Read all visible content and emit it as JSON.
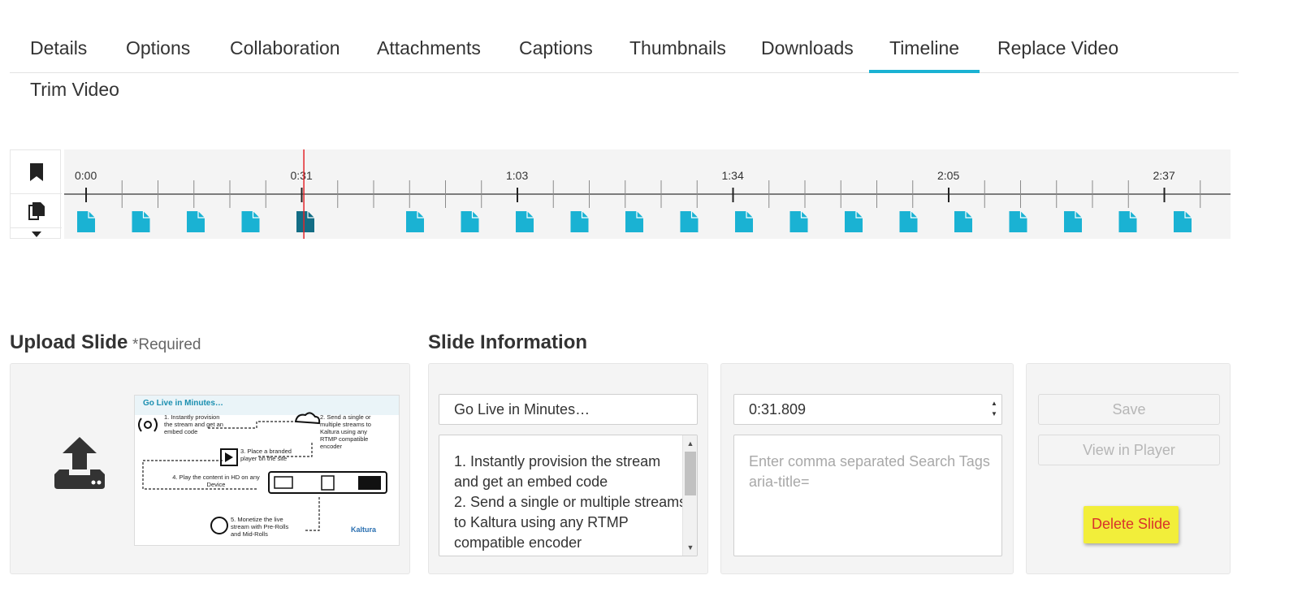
{
  "tabs": [
    {
      "label": "Details"
    },
    {
      "label": "Options"
    },
    {
      "label": "Collaboration"
    },
    {
      "label": "Attachments"
    },
    {
      "label": "Captions"
    },
    {
      "label": "Thumbnails"
    },
    {
      "label": "Downloads"
    },
    {
      "label": "Timeline",
      "active": true
    },
    {
      "label": "Replace Video"
    },
    {
      "label": "Trim Video"
    }
  ],
  "timeline": {
    "side_buttons": [
      "bookmark-icon",
      "copy-slides-icon",
      "caret-down-icon"
    ],
    "tick_labels": [
      "0:00",
      "0:31",
      "1:03",
      "1:34",
      "2:05",
      "2:37"
    ],
    "playhead_time": "0:31",
    "accent_color": "#1ab2d3",
    "selected_color": "#136d85",
    "playhead_color": "#e3262b",
    "slide_markers": [
      0,
      1,
      2,
      3,
      4,
      6,
      7,
      8,
      9,
      10,
      11,
      12,
      13,
      14,
      15,
      16,
      17,
      18,
      19,
      20
    ],
    "selected_marker": 4
  },
  "upload": {
    "title": "Upload Slide",
    "required": "*Required",
    "icon": "upload-icon",
    "slide_preview": {
      "title": "Go Live in Minutes…",
      "step1": "1. Instantly provision the stream and get an embed code",
      "step2": "2. Send a single or multiple streams to Kaltura using any RTMP compatible encoder",
      "step3": "3. Place a branded player on the site",
      "step4": "4. Play the content in HD on any Device",
      "step5": "5. Monetize the live stream with Pre-Rolls and Mid-Rolls",
      "logo": "Kaltura"
    }
  },
  "slide_info": {
    "title": "Slide Information",
    "title_value": "Go Live in Minutes…",
    "description_lines": [
      "1. Instantly provision the stream",
      "and get an embed code",
      "2. Send a single or multiple streams",
      "to Kaltura using any RTMP",
      "compatible encoder"
    ],
    "time_value": "0:31.809",
    "tags_placeholder_lines": [
      "Enter comma separated Search Tags",
      "aria-title="
    ]
  },
  "actions": {
    "save": "Save",
    "view_in_player": "View in Player",
    "delete": "Delete Slide"
  }
}
